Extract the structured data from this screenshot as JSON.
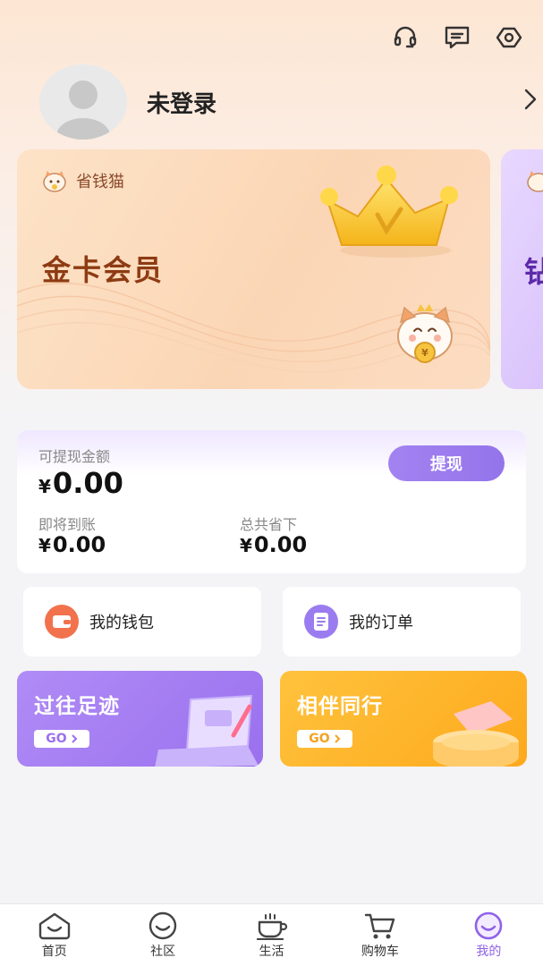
{
  "header": {
    "icons": [
      "headset-icon",
      "message-icon",
      "settings-icon"
    ]
  },
  "profile": {
    "name": "未登录"
  },
  "member_card": {
    "brand": "省钱猫",
    "title": "金卡会员",
    "next_card_char": "钻"
  },
  "wallet": {
    "withdrawable_label": "可提现金额",
    "currency": "¥",
    "withdrawable_value": "0.00",
    "withdraw_button": "提现",
    "pending_label": "即将到账",
    "pending_value": "0.00",
    "saved_label": "总共省下",
    "saved_value": "0.00"
  },
  "quick_links": [
    {
      "label": "我的钱包",
      "icon": "wallet-icon",
      "color": "#f2724d"
    },
    {
      "label": "我的订单",
      "icon": "order-icon",
      "color": "#9b7cf0"
    }
  ],
  "promos": [
    {
      "title": "过往足迹",
      "go": "GO",
      "color": "#a27cf2"
    },
    {
      "title": "相伴同行",
      "go": "GO",
      "color": "#fdb12b"
    }
  ],
  "tabbar": {
    "items": [
      {
        "label": "首页",
        "icon": "home-icon"
      },
      {
        "label": "社区",
        "icon": "community-icon"
      },
      {
        "label": "生活",
        "icon": "coffee-icon"
      },
      {
        "label": "购物车",
        "icon": "cart-icon"
      },
      {
        "label": "我的",
        "icon": "profile-smile-icon"
      }
    ],
    "active_index": 4,
    "active_color": "#8f62e8"
  }
}
